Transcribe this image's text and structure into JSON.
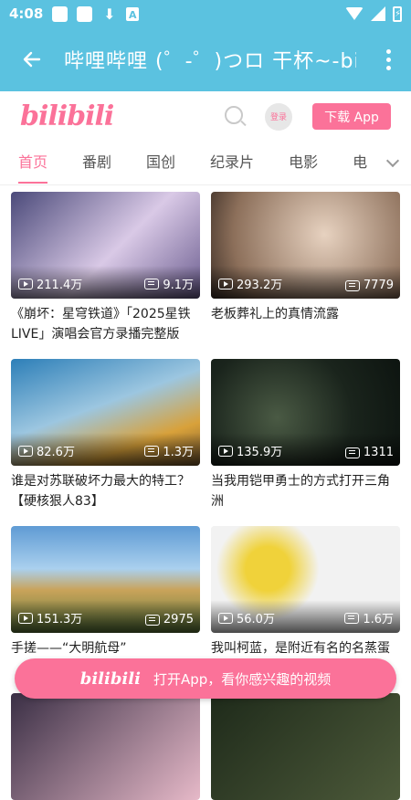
{
  "status": {
    "time": "4:08"
  },
  "app_bar": {
    "title": "哔哩哔哩 (゜-゜)つロ 干杯~-bilibili"
  },
  "header": {
    "logo": "bilibili",
    "login_label": "登录",
    "download_label": "下载 App"
  },
  "tabs": [
    {
      "label": "首页",
      "active": true
    },
    {
      "label": "番剧",
      "active": false
    },
    {
      "label": "国创",
      "active": false
    },
    {
      "label": "纪录片",
      "active": false
    },
    {
      "label": "电影",
      "active": false
    },
    {
      "label": "电",
      "active": false
    }
  ],
  "videos": [
    {
      "title": "《崩坏：星穹铁道》「2025星铁LIVE」演唱会官方录播完整版",
      "views": "211.4万",
      "danmaku": "9.1万",
      "colors": [
        "#4b4a7a",
        "#d9c9e6"
      ]
    },
    {
      "title": "老板葬礼上的真情流露",
      "views": "293.2万",
      "danmaku": "7779",
      "colors": [
        "#8c6f5a",
        "#e7d2c0"
      ]
    },
    {
      "title": "谁是对苏联破坏力最大的特工？【硬核狠人83】",
      "views": "82.6万",
      "danmaku": "1.3万",
      "colors": [
        "#2d7fb8",
        "#d8a13a"
      ]
    },
    {
      "title": "当我用铠甲勇士的方式打开三角洲",
      "views": "135.9万",
      "danmaku": "1311",
      "colors": [
        "#0d1410",
        "#4a5a44"
      ]
    },
    {
      "title": "手搓——“大明航母”",
      "views": "151.3万",
      "danmaku": "2975",
      "colors": [
        "#5f9bd4",
        "#c9a35a"
      ]
    },
    {
      "title": "我叫柯蓝，是附近有名的名蒸蛋",
      "views": "56.0万",
      "danmaku": "1.6万",
      "colors": [
        "#f2f2f2",
        "#f0d23a"
      ]
    }
  ],
  "banner": {
    "logo": "bilibili",
    "text": "打开App，看你感兴趣的视频"
  }
}
